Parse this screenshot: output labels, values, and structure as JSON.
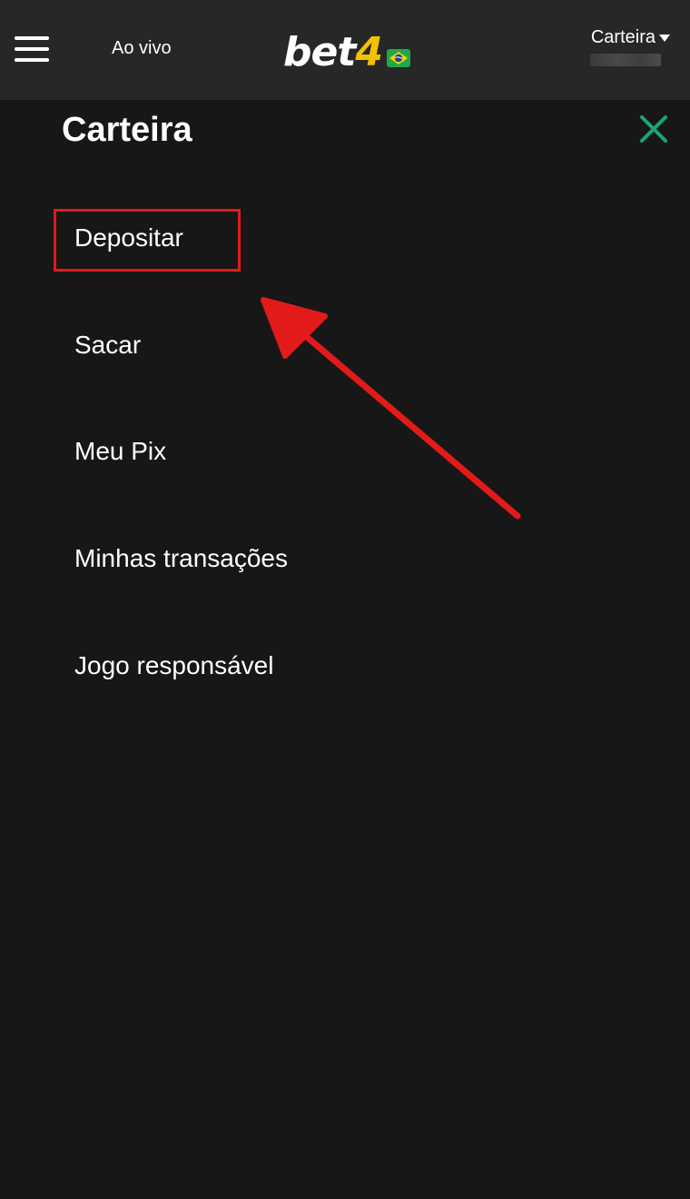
{
  "header": {
    "live_label": "Ao vivo",
    "logo_text_main": "bet",
    "logo_text_accent": "4",
    "wallet_menu_label": "Carteira",
    "icons": {
      "menu": "hamburger-menu-icon",
      "flag": "brazil-flag-icon",
      "caret": "caret-down-icon"
    }
  },
  "panel": {
    "title": "Carteira",
    "close_icon": "close-icon",
    "items": [
      {
        "label": "Depositar"
      },
      {
        "label": "Sacar"
      },
      {
        "label": "Meu Pix"
      },
      {
        "label": "Minhas transações"
      },
      {
        "label": "Jogo responsável"
      }
    ]
  },
  "colors": {
    "background": "#171717",
    "header_background": "#272727",
    "close_icon": "#1aa37a",
    "logo_accent": "#f2c200",
    "annotation_red": "#e31a1a"
  }
}
